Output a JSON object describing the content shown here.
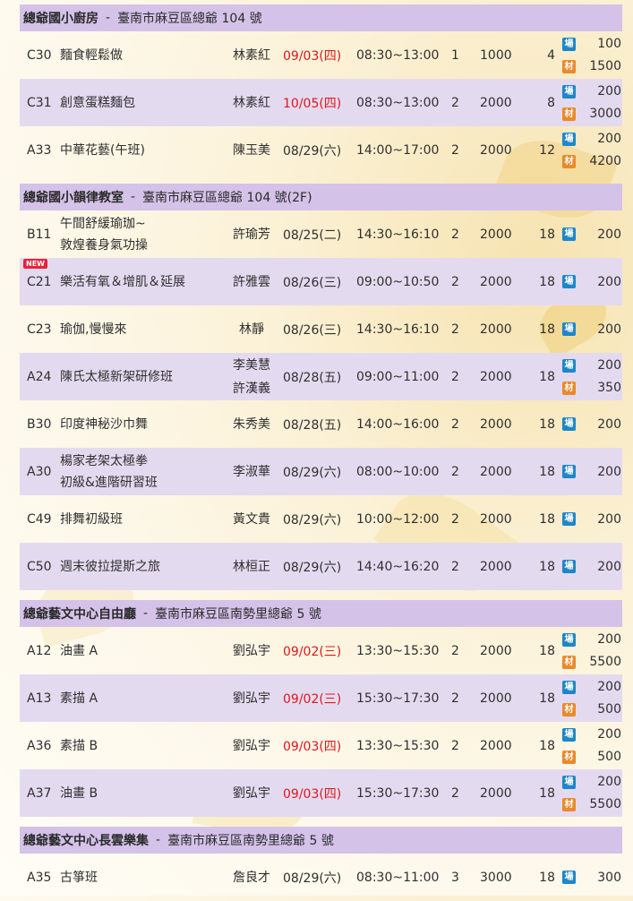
{
  "sections": [
    {
      "name": "總爺國小廚房",
      "address": "臺南市麻豆區總爺 104 號",
      "rows": [
        {
          "code": "C30",
          "course": [
            "麵食輕鬆做"
          ],
          "teacher": [
            "林素紅"
          ],
          "date": "09/03(四)",
          "date_red": true,
          "time": "08:30~13:00",
          "weeks": "1",
          "fee": "1000",
          "people": "4",
          "venue": "100",
          "material": "1500"
        },
        {
          "code": "C31",
          "course": [
            "創意蛋糕麵包"
          ],
          "teacher": [
            "林素紅"
          ],
          "date": "10/05(四)",
          "date_red": true,
          "time": "08:30~13:00",
          "weeks": "2",
          "fee": "2000",
          "people": "8",
          "venue": "200",
          "material": "3000"
        },
        {
          "code": "A33",
          "course": [
            "中華花藝(午班)"
          ],
          "teacher": [
            "陳玉美"
          ],
          "date": "08/29(六)",
          "date_red": false,
          "time": "14:00~17:00",
          "weeks": "2",
          "fee": "2000",
          "people": "12",
          "venue": "200",
          "material": "4200"
        }
      ]
    },
    {
      "name": "總爺國小韻律教室",
      "address": "臺南市麻豆區總爺 104 號(2F)",
      "rows": [
        {
          "code": "B11",
          "course": [
            "午間舒緩瑜珈~",
            "敦煌養身氣功操"
          ],
          "teacher": [
            "許瑜芳"
          ],
          "date": "08/25(二)",
          "date_red": false,
          "time": "14:30~16:10",
          "weeks": "2",
          "fee": "2000",
          "people": "18",
          "venue": "200"
        },
        {
          "code": "C21",
          "is_new": true,
          "course": [
            "樂活有氧＆增肌＆延展"
          ],
          "teacher": [
            "許雅雲"
          ],
          "date": "08/26(三)",
          "date_red": false,
          "time": "09:00~10:50",
          "weeks": "2",
          "fee": "2000",
          "people": "18",
          "venue": "200"
        },
        {
          "code": "C23",
          "course": [
            "瑜伽,慢慢來"
          ],
          "teacher": [
            "林靜"
          ],
          "date": "08/26(三)",
          "date_red": false,
          "time": "14:30~16:10",
          "weeks": "2",
          "fee": "2000",
          "people": "18",
          "venue": "200"
        },
        {
          "code": "A24",
          "course": [
            "陳氏太極新架研修班"
          ],
          "teacher": [
            "李美慧",
            "許漢義"
          ],
          "date": "08/28(五)",
          "date_red": false,
          "time": "09:00~11:00",
          "weeks": "2",
          "fee": "2000",
          "people": "18",
          "venue": "200",
          "material": "350"
        },
        {
          "code": "B30",
          "course": [
            "印度神秘沙巾舞"
          ],
          "teacher": [
            "朱秀美"
          ],
          "date": "08/28(五)",
          "date_red": false,
          "time": "14:00~16:00",
          "weeks": "2",
          "fee": "2000",
          "people": "18",
          "venue": "200"
        },
        {
          "code": "A30",
          "course": [
            "楊家老架太極拳",
            "初級&進階研習班"
          ],
          "teacher": [
            "李淑華"
          ],
          "date": "08/29(六)",
          "date_red": false,
          "time": "08:00~10:00",
          "weeks": "2",
          "fee": "2000",
          "people": "18",
          "venue": "200"
        },
        {
          "code": "C49",
          "course": [
            "排舞初級班"
          ],
          "teacher": [
            "黃文貴"
          ],
          "date": "08/29(六)",
          "date_red": false,
          "time": "10:00~12:00",
          "weeks": "2",
          "fee": "2000",
          "people": "18",
          "venue": "200"
        },
        {
          "code": "C50",
          "course": [
            "週末彼拉提斯之旅"
          ],
          "teacher": [
            "林桓正"
          ],
          "date": "08/29(六)",
          "date_red": false,
          "time": "14:40~16:20",
          "weeks": "2",
          "fee": "2000",
          "people": "18",
          "venue": "200"
        }
      ]
    },
    {
      "name": "總爺藝文中心自由廳",
      "address": "臺南市麻豆區南勢里總爺 5 號",
      "rows": [
        {
          "code": "A12",
          "course": [
            "油畫 A"
          ],
          "teacher": [
            "劉弘宇"
          ],
          "date": "09/02(三)",
          "date_red": true,
          "time": "13:30~15:30",
          "weeks": "2",
          "fee": "2000",
          "people": "18",
          "venue": "200",
          "material": "5500"
        },
        {
          "code": "A13",
          "course": [
            "素描 A"
          ],
          "teacher": [
            "劉弘宇"
          ],
          "date": "09/02(三)",
          "date_red": true,
          "time": "15:30~17:30",
          "weeks": "2",
          "fee": "2000",
          "people": "18",
          "venue": "200",
          "material": "500"
        },
        {
          "code": "A36",
          "course": [
            "素描 B"
          ],
          "teacher": [
            "劉弘宇"
          ],
          "date": "09/03(四)",
          "date_red": true,
          "time": "13:30~15:30",
          "weeks": "2",
          "fee": "2000",
          "people": "18",
          "venue": "200",
          "material": "500"
        },
        {
          "code": "A37",
          "course": [
            "油畫 B"
          ],
          "teacher": [
            "劉弘宇"
          ],
          "date": "09/03(四)",
          "date_red": true,
          "time": "15:30~17:30",
          "weeks": "2",
          "fee": "2000",
          "people": "18",
          "venue": "200",
          "material": "5500"
        }
      ]
    },
    {
      "name": "總爺藝文中心長雲樂集",
      "address": "臺南市麻豆區南勢里總爺 5 號",
      "rows": [
        {
          "code": "A35",
          "course": [
            "古箏班"
          ],
          "teacher": [
            "詹良才"
          ],
          "date": "08/29(六)",
          "date_red": false,
          "time": "08:30~11:00",
          "weeks": "3",
          "fee": "3000",
          "people": "18",
          "venue": "300"
        }
      ]
    }
  ],
  "labels": {
    "venue_icon": "場",
    "material_icon": "材",
    "new_badge": "NEW",
    "separator": "-"
  },
  "colors": {
    "header_bg": "#d4c2e9",
    "row_shade": "#e4daf0",
    "date_red": "#e0161b",
    "venue_icon": "#1f86c8",
    "material_icon": "#e98a2b"
  }
}
